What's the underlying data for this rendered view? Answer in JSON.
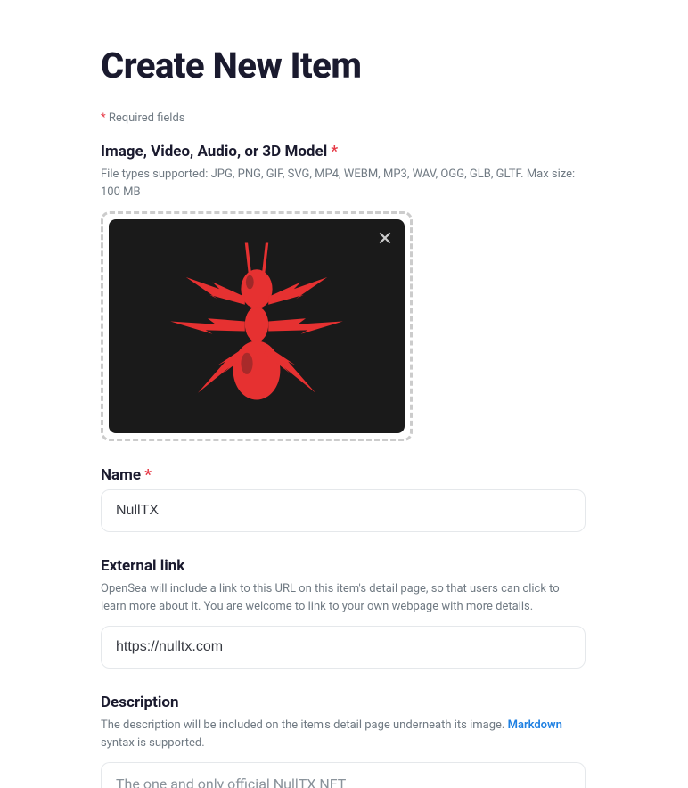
{
  "page_title": "Create New Item",
  "required_note": "Required fields",
  "fields": {
    "media": {
      "label": "Image, Video, Audio, or 3D Model",
      "required": true,
      "help": "File types supported: JPG, PNG, GIF, SVG, MP4, WEBM, MP3, WAV, OGG, GLB, GLTF. Max size: 100 MB"
    },
    "name": {
      "label": "Name",
      "required": true,
      "value": "NullTX"
    },
    "external_link": {
      "label": "External link",
      "help": "OpenSea will include a link to this URL on this item's detail page, so that users can click to learn more about it. You are welcome to link to your own webpage with more details.",
      "value": "https://nulltx.com"
    },
    "description": {
      "label": "Description",
      "help_prefix": "The description will be included on the item's detail page underneath its image. ",
      "help_link_text": "Markdown",
      "help_suffix": " syntax is supported.",
      "value": "The one and only official NullTX NFT"
    }
  }
}
